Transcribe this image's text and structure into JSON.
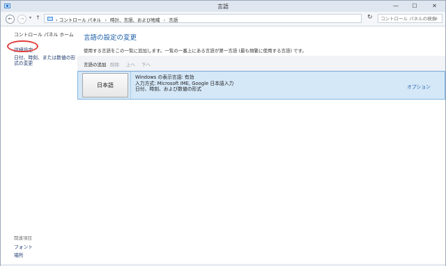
{
  "window": {
    "title": "言語",
    "controls": {
      "minimize": "—",
      "maximize": "☐",
      "close": "✕"
    }
  },
  "address": {
    "back": "←",
    "forward": "→",
    "history_dropdown": "▾",
    "up": "↑",
    "crumbs": [
      "コントロール パネル",
      "時計、言語、および地域",
      "言語"
    ],
    "separator": "›",
    "dropdown": "▾",
    "refresh": "↻",
    "search_placeholder": "コントロール パネルの検索",
    "search_icon": "⌕"
  },
  "sidebar": {
    "home": "コントロール パネル ホーム",
    "advanced": "詳細設定",
    "date_time": "日付、時刻、または数値の形式の変更",
    "related_heading": "関連項目",
    "related_font": "フォント",
    "related_location": "場所"
  },
  "main": {
    "title": "言語の設定の変更",
    "description": "使用する言語をこの一覧に追加します。一覧の一番上にある言語が第一言語 (最も頻繁に使用する言語) です。",
    "toolbar": {
      "add": "言語の追加",
      "remove": "削除",
      "up": "上へ",
      "down": "下へ"
    },
    "languages": [
      {
        "name": "日本語",
        "lines": [
          "Windows の表示言語: 有効",
          "入力方式: Microsoft IME, Google 日本語入力",
          "日付、時刻、および数値の形式"
        ],
        "options": "オプション"
      }
    ]
  },
  "colors": {
    "accent": "#1d5fa8",
    "selected_row": "#d5e8f8",
    "annotation_circle": "#e03c3c"
  }
}
